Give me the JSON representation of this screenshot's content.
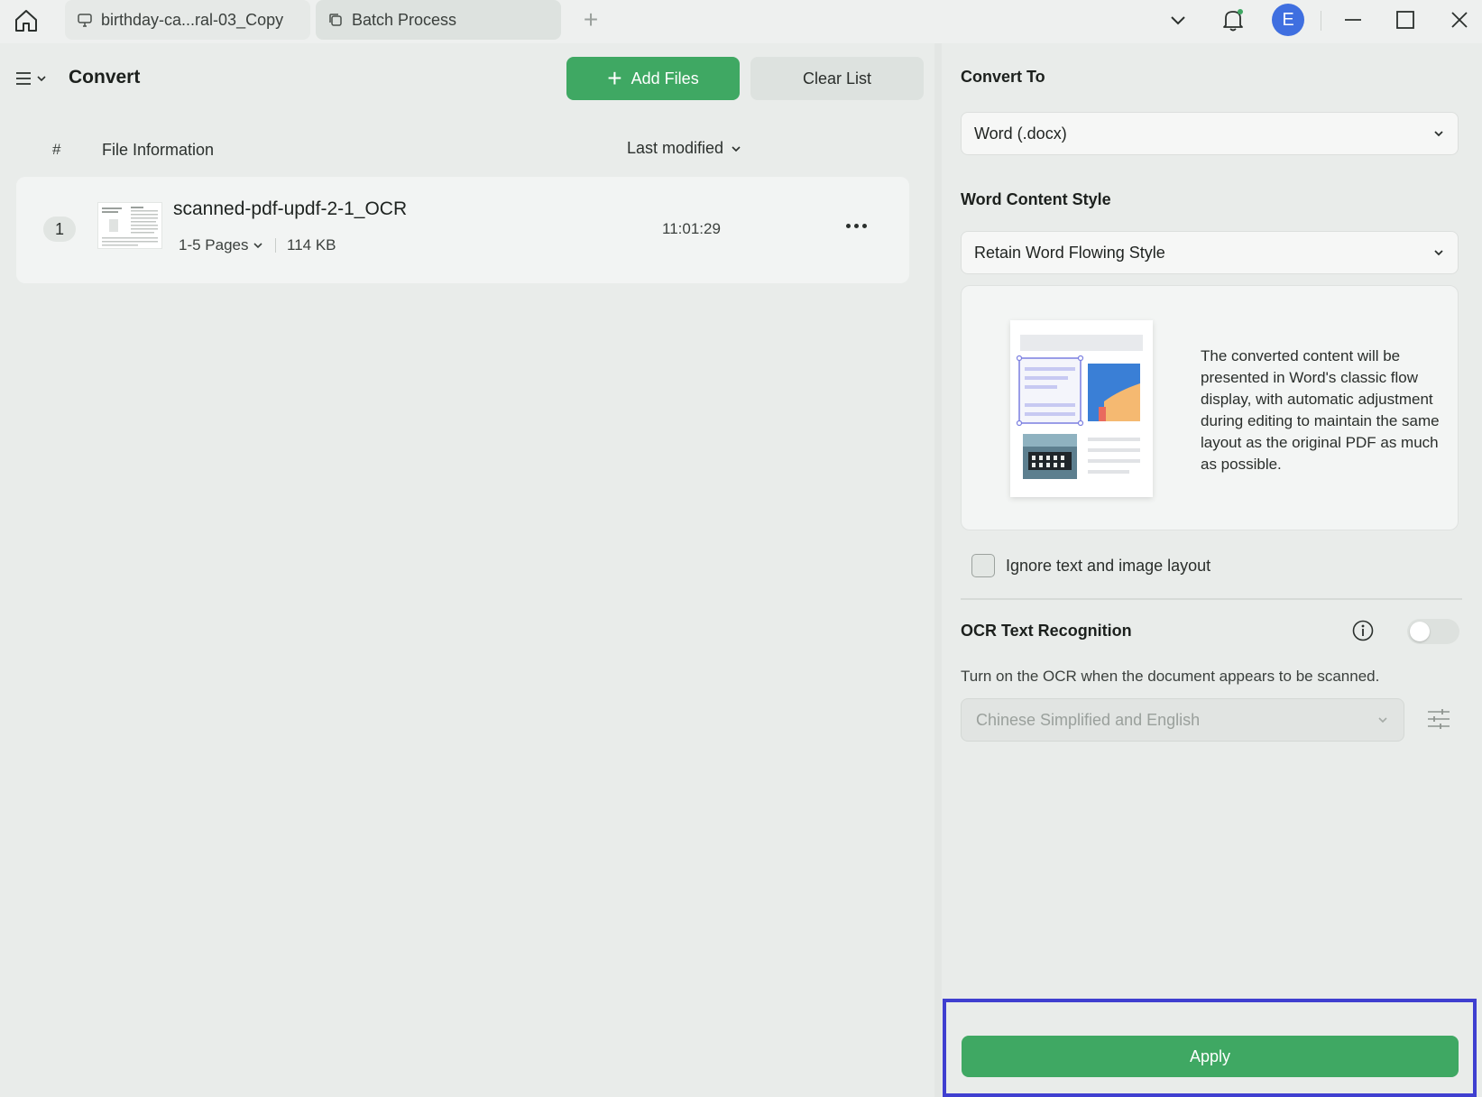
{
  "titlebar": {
    "tabs": [
      {
        "label": "birthday-ca...ral-03_Copy",
        "icon": "monitor-icon"
      },
      {
        "label": "Batch Process",
        "icon": "copy-icon"
      }
    ],
    "avatar_initial": "E"
  },
  "left_panel": {
    "title": "Convert",
    "add_files_label": "Add Files",
    "clear_list_label": "Clear List",
    "columns": {
      "index": "#",
      "file_info": "File Information",
      "sort": "Last modified"
    },
    "files": [
      {
        "index": "1",
        "name": "scanned-pdf-updf-2-1_OCR",
        "pages": "1-5 Pages",
        "size": "114 KB",
        "time": "11:01:29"
      }
    ]
  },
  "right_panel": {
    "convert_to_label": "Convert To",
    "convert_to_value": "Word (.docx)",
    "content_style_label": "Word Content Style",
    "content_style_value": "Retain Word Flowing Style",
    "preview_description": "The converted content will be presented in Word's classic flow display, with automatic adjustment during editing to maintain the same layout as the original PDF as much as possible.",
    "ignore_layout_label": "Ignore text and image layout",
    "ignore_layout_checked": false,
    "ocr_label": "OCR Text Recognition",
    "ocr_enabled": false,
    "ocr_hint": "Turn on the OCR when the document appears to be scanned.",
    "ocr_language": "Chinese Simplified and English",
    "apply_label": "Apply"
  },
  "colors": {
    "accent_green": "#3fa863",
    "avatar_blue": "#3f6fe0",
    "highlight_frame": "#3f3fd0"
  }
}
